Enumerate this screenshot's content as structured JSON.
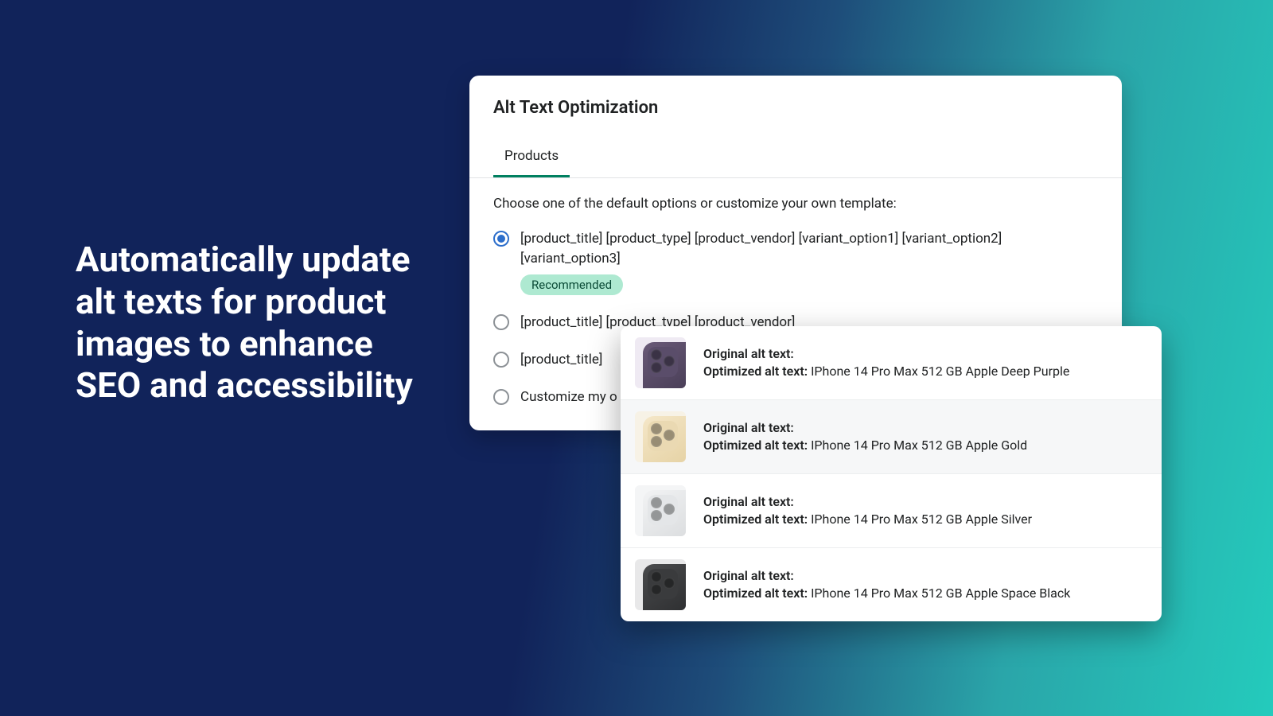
{
  "headline": "Automatically update alt texts for product images to enhance SEO and accessibility",
  "card": {
    "title": "Alt Text Optimization",
    "tab": "Products",
    "instruction": "Choose one of the default options or customize your own template:",
    "recommended_badge": "Recommended",
    "options": [
      "[product_title] [product_type] [product_vendor] [variant_option1] [variant_option2] [variant_option3]",
      "[product_title] [product_type] [product_vendor]",
      "[product_title]",
      "Customize my o"
    ]
  },
  "preview": {
    "original_label": "Original alt text:",
    "optimized_label": "Optimized alt text:",
    "rows": [
      {
        "variant": "purple",
        "optimized": "IPhone 14 Pro Max 512 GB Apple Deep Purple"
      },
      {
        "variant": "gold",
        "optimized": "IPhone 14 Pro Max 512 GB Apple Gold"
      },
      {
        "variant": "silver",
        "optimized": "IPhone 14 Pro Max 512 GB Apple Silver"
      },
      {
        "variant": "black",
        "optimized": "IPhone 14 Pro Max 512 GB Apple Space Black"
      }
    ]
  }
}
